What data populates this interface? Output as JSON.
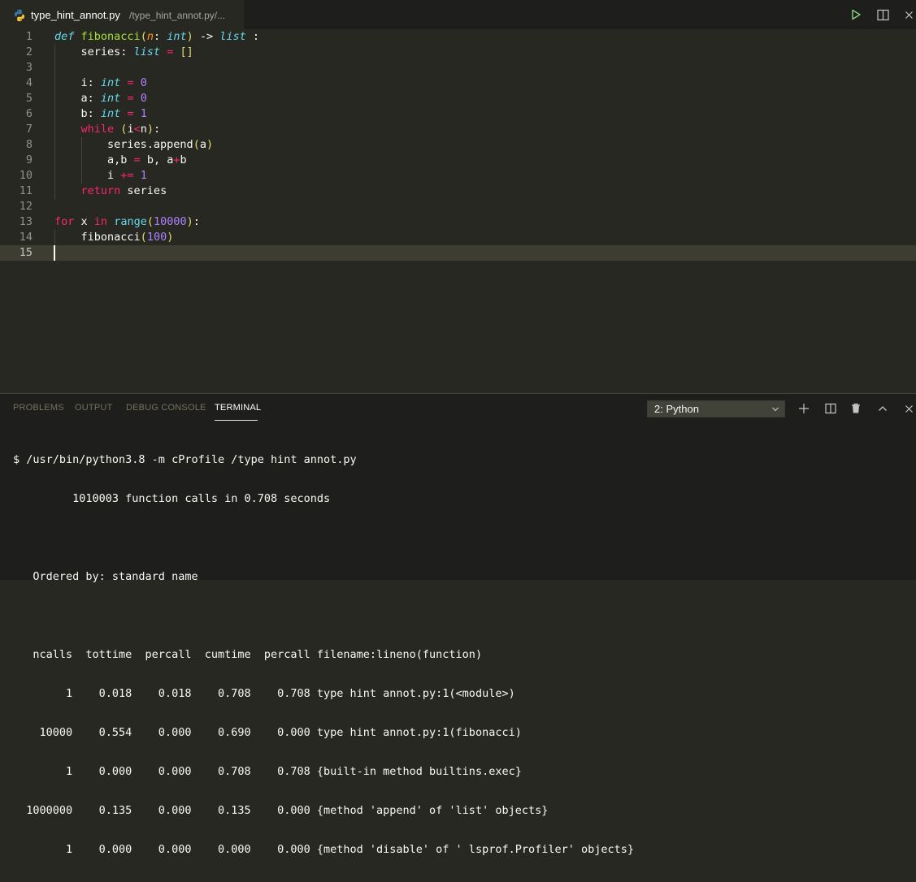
{
  "tab": {
    "filename": "type_hint_annot.py",
    "path": "/type_hint_annot.py/..."
  },
  "editor": {
    "line_numbers": [
      "1",
      "2",
      "3",
      "4",
      "5",
      "6",
      "7",
      "8",
      "9",
      "10",
      "11",
      "12",
      "13",
      "14",
      "15"
    ],
    "current_line": "15"
  },
  "panel": {
    "tabs": [
      "PROBLEMS",
      "OUTPUT",
      "DEBUG CONSOLE",
      "TERMINAL"
    ],
    "active_tab": "TERMINAL",
    "terminal_selected": "2: Python"
  },
  "terminal": {
    "lines": [
      "$ /usr/bin/python3.8 -m cProfile /type hint annot.py",
      "         1010003 function calls in 0.708 seconds",
      "",
      "   Ordered by: standard name",
      "",
      "   ncalls  tottime  percall  cumtime  percall filename:lineno(function)",
      "        1    0.018    0.018    0.708    0.708 type hint annot.py:1(<module>)",
      "    10000    0.554    0.000    0.690    0.000 type hint annot.py:1(fibonacci)",
      "        1    0.000    0.000    0.708    0.708 {built-in method builtins.exec}",
      "  1000000    0.135    0.000    0.135    0.000 {method 'append' of 'list' objects}",
      "        1    0.000    0.000    0.000    0.000 {method 'disable' of ' lsprof.Profiler' objects}"
    ]
  },
  "colors": {
    "editor_bg": "#272822",
    "keyword": "#66d9ef",
    "function": "#a6e22e",
    "parameter": "#fd971f",
    "operator": "#f92672",
    "number": "#ae81ff",
    "run_icon": "#89d185"
  },
  "icons": {
    "file": "python-icon",
    "run": "run-icon",
    "split": "split-editor-icon",
    "close": "close-icon",
    "add": "plus-icon",
    "split_terminal": "split-terminal-icon",
    "trash": "trash-icon",
    "maximize": "chevron-up-icon",
    "close_panel": "close-icon"
  }
}
